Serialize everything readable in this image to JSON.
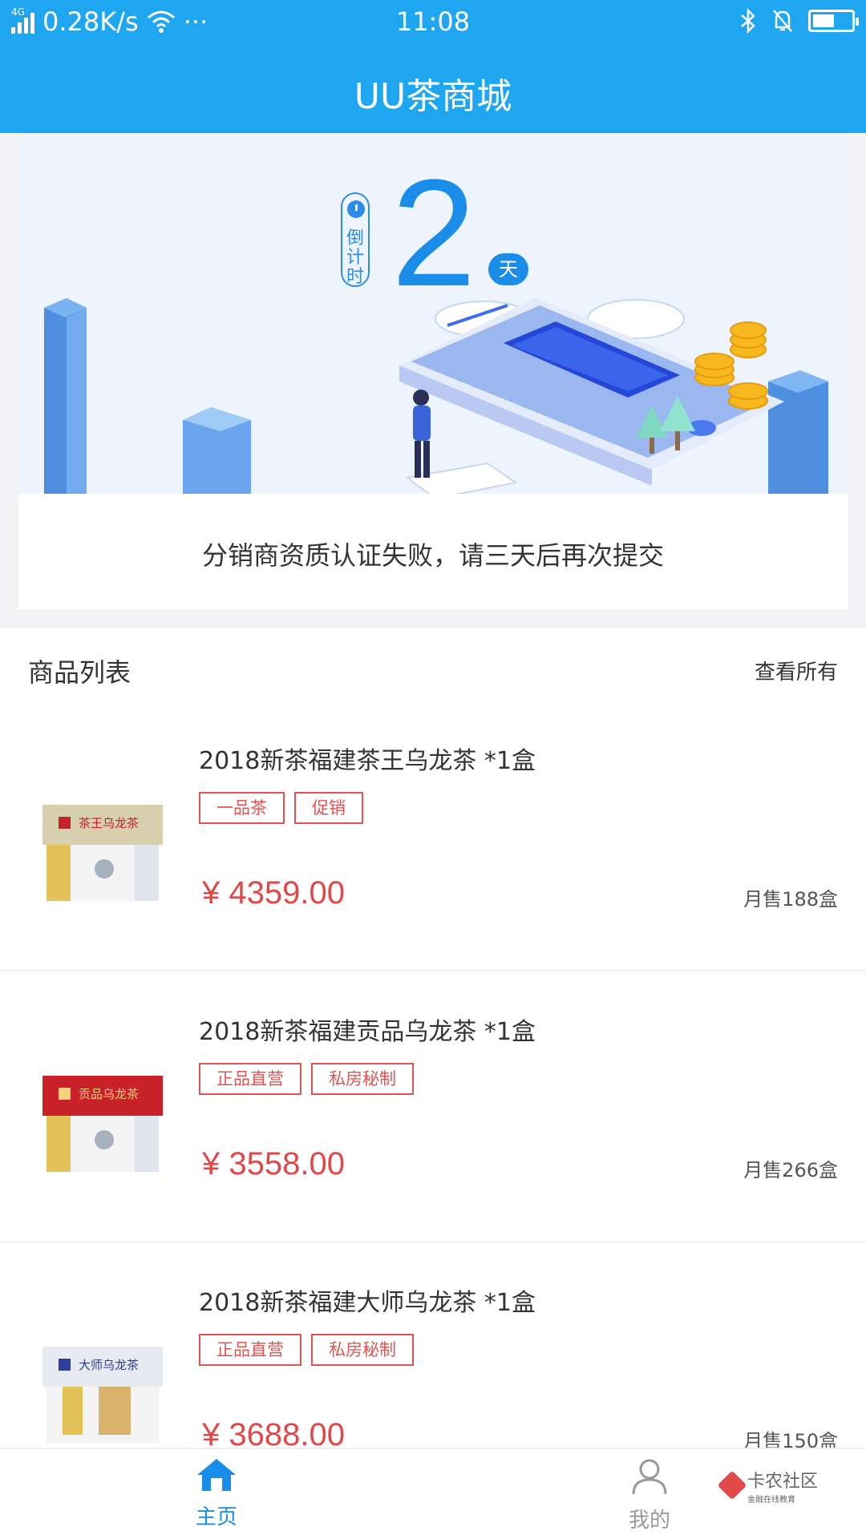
{
  "status_bar": {
    "network": "4G",
    "speed": "0.28K/s",
    "dots": "···",
    "time": "11:08"
  },
  "header": {
    "title": "UU茶商城"
  },
  "banner": {
    "countdown_label": "倒\n计\n时",
    "countdown_value": "2",
    "countdown_unit": "天"
  },
  "notice": {
    "text": "分销商资质认证失败，请三天后再次提交"
  },
  "product_list": {
    "title": "商品列表",
    "view_all": "查看所有",
    "items": [
      {
        "name": "2018新茶福建茶王乌龙茶 *1盒",
        "tags": [
          "一品茶",
          "促销"
        ],
        "price": "¥ 4359.00",
        "sales": "月售188盒",
        "box_color": "#d8cfae",
        "box_label": "茶王乌龙茶"
      },
      {
        "name": "2018新茶福建贡品乌龙茶 *1盒",
        "tags": [
          "正品直营",
          "私房秘制"
        ],
        "price": "¥ 3558.00",
        "sales": "月售266盒",
        "box_color": "#c8212a",
        "box_label": "贡品乌龙茶"
      },
      {
        "name": "2018新茶福建大师乌龙茶  *1盒",
        "tags": [
          "正品直营",
          "私房秘制"
        ],
        "price": "¥ 3688.00",
        "sales": "月售150盒",
        "box_color": "#e8eaf2",
        "box_label": "大师乌龙茶"
      }
    ]
  },
  "bottom_nav": {
    "home_label": "主页",
    "me_label": "我的"
  },
  "watermark": {
    "text": "卡农社区",
    "sub": "金融在线教育"
  },
  "colors": {
    "primary": "#1ea6f0",
    "price": "#e04848",
    "tag": "#e15353"
  }
}
